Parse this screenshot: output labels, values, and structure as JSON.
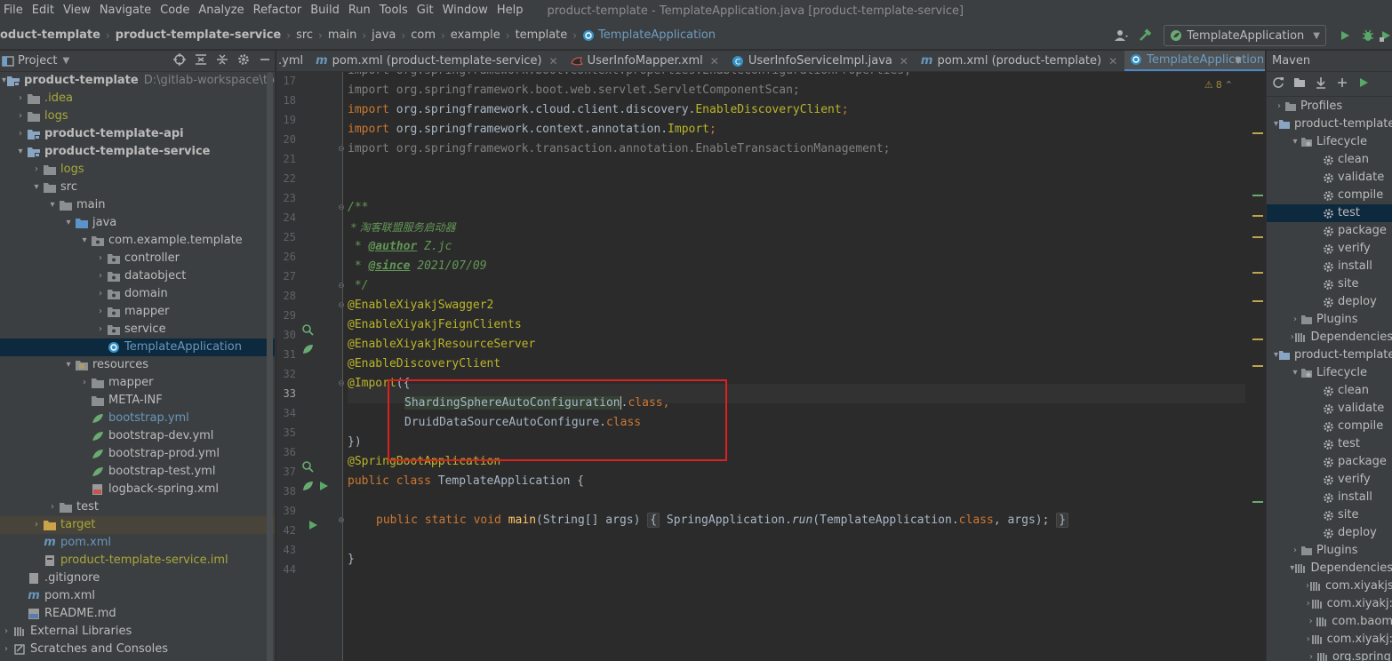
{
  "menu": {
    "items": [
      "File",
      "Edit",
      "View",
      "Navigate",
      "Code",
      "Analyze",
      "Refactor",
      "Build",
      "Run",
      "Tools",
      "Git",
      "Window",
      "Help"
    ],
    "window_title": "product-template - TemplateApplication.java [product-template-service]"
  },
  "breadcrumb": {
    "items": [
      "oduct-template",
      "product-template-service",
      "src",
      "main",
      "java",
      "com",
      "example",
      "template",
      "TemplateApplication"
    ]
  },
  "toolbar": {
    "run_config": "TemplateApplication"
  },
  "project_panel": {
    "title": "Project",
    "tree": [
      {
        "label": "product-template",
        "path": "D:\\gitlab-workspace\\tool\\p",
        "bold": true
      },
      {
        "label": ".idea"
      },
      {
        "label": "logs"
      },
      {
        "label": "product-template-api"
      },
      {
        "label": "product-template-service"
      },
      {
        "label": "logs"
      },
      {
        "label": "src"
      },
      {
        "label": "main"
      },
      {
        "label": "java"
      },
      {
        "label": "com.example.template"
      },
      {
        "label": "controller"
      },
      {
        "label": "dataobject"
      },
      {
        "label": "domain"
      },
      {
        "label": "mapper"
      },
      {
        "label": "service"
      },
      {
        "label": "TemplateApplication"
      },
      {
        "label": "resources"
      },
      {
        "label": "mapper"
      },
      {
        "label": "META-INF"
      },
      {
        "label": "bootstrap.yml"
      },
      {
        "label": "bootstrap-dev.yml"
      },
      {
        "label": "bootstrap-prod.yml"
      },
      {
        "label": "bootstrap-test.yml"
      },
      {
        "label": "logback-spring.xml"
      },
      {
        "label": "test"
      },
      {
        "label": "target"
      },
      {
        "label": "pom.xml"
      },
      {
        "label": "product-template-service.iml"
      },
      {
        "label": ".gitignore"
      },
      {
        "label": "pom.xml"
      },
      {
        "label": "README.md"
      },
      {
        "label": "External Libraries"
      },
      {
        "label": "Scratches and Consoles"
      }
    ]
  },
  "editor": {
    "tabs": [
      {
        "label": ".yml"
      },
      {
        "label": "pom.xml (product-template-service)"
      },
      {
        "label": "UserInfoMapper.xml"
      },
      {
        "label": "UserInfoServiceImpl.java"
      },
      {
        "label": "pom.xml (product-template)"
      },
      {
        "label": "TemplateApplication.java"
      }
    ],
    "warnings": "8",
    "line_numbers": [
      "17",
      "18",
      "19",
      "20",
      "21",
      "22",
      "23",
      "24",
      "25",
      "26",
      "27",
      "28",
      "29",
      "30",
      "31",
      "32",
      "33",
      "34",
      "35",
      "36",
      "37",
      "38",
      "39",
      "42",
      "43",
      "44"
    ],
    "code": {
      "l16": "import org.springframework.boot.context.properties.EnableConfigurationProperties;",
      "l17_kw": "import",
      "l17_rest": " org.springframework.boot.web.servlet.ServletComponentScan;",
      "l18_kw": "import",
      "l18_pkg": " org.springframework.cloud.client.discovery.",
      "l18_ann": "EnableDiscoveryClient",
      "l18_end": ";",
      "l19_kw": "import",
      "l19_pkg": " org.springframework.context.annotation.",
      "l19_ann": "Import",
      "l19_end": ";",
      "l20": "import org.springframework.transaction.annotation.EnableTransactionManagement;",
      "l23": "/**",
      "l24": " * 淘客联盟服务启动器",
      "l25_pre": " * ",
      "l25_tag": "@author",
      "l25_val": " Z.jc",
      "l26_pre": " * ",
      "l26_tag": "@since",
      "l26_val": " 2021/07/09",
      "l27": " */",
      "l28": "@EnableXiyakjSwagger2",
      "l29": "@EnableXiyakjFeignClients",
      "l30": "@EnableXiyakjResourceServer",
      "l31": "@EnableDiscoveryClient",
      "l32_ann": "@Import",
      "l32_rest": "({",
      "l33_cls": "ShardingSphereAutoConfiguration",
      "l33_dot": ".",
      "l33_kw": "class",
      "l33_end": ",",
      "l34_cls": "DruidDataSourceAutoConfigure.",
      "l34_kw": "class",
      "l35": "})",
      "l36": "@SpringBootApplication",
      "l37_kw": "public class",
      "l37_rest": " TemplateApplication {",
      "l39_kw": "public static void",
      "l39_fn": "main",
      "l39_args": "(String[] args)",
      "l39_open": "{",
      "l39_body1": " SpringApplication.",
      "l39_run": "run",
      "l39_body2": "(TemplateApplication.",
      "l39_kw2": "class",
      "l39_body3": ", args);",
      "l39_close": "}",
      "l43": "}"
    }
  },
  "maven_panel": {
    "title": "Maven",
    "tree": [
      {
        "label": "Profiles"
      },
      {
        "label": "product-template"
      },
      {
        "label": "Lifecycle"
      },
      {
        "label": "clean"
      },
      {
        "label": "validate"
      },
      {
        "label": "compile"
      },
      {
        "label": "test"
      },
      {
        "label": "package"
      },
      {
        "label": "verify"
      },
      {
        "label": "install"
      },
      {
        "label": "site"
      },
      {
        "label": "deploy"
      },
      {
        "label": "Plugins"
      },
      {
        "label": "Dependencies"
      },
      {
        "label": "product-template"
      },
      {
        "label": "Lifecycle"
      },
      {
        "label": "clean"
      },
      {
        "label": "validate"
      },
      {
        "label": "compile"
      },
      {
        "label": "test"
      },
      {
        "label": "package"
      },
      {
        "label": "verify"
      },
      {
        "label": "install"
      },
      {
        "label": "site"
      },
      {
        "label": "deploy"
      },
      {
        "label": "Plugins"
      },
      {
        "label": "Dependencies"
      },
      {
        "label": "com.xiyakjs"
      },
      {
        "label": "com.xiyakj:"
      },
      {
        "label": "com.baom"
      },
      {
        "label": "com.xiyakj:"
      },
      {
        "label": "org.spring"
      }
    ]
  },
  "colors": {
    "background": "#2b2b2b",
    "panel": "#3c3f41",
    "keyword": "#cc7832",
    "annotation": "#bbb529",
    "comment": "#629755",
    "selection": "#0d293e",
    "highlight_box": "#e02020"
  }
}
